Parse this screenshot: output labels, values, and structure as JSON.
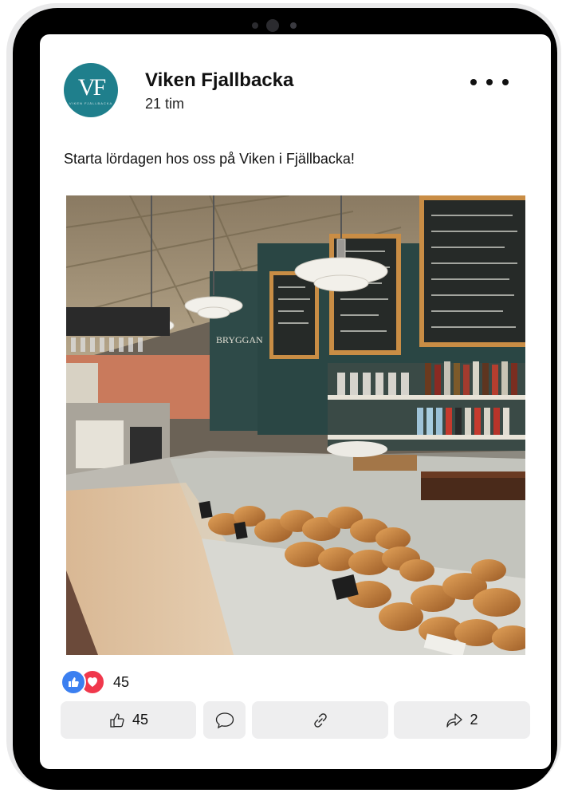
{
  "post": {
    "page_name": "Viken Fjallbacka",
    "timestamp": "21 tim",
    "text": "Starta lördagen hos oss på Viken i Fjällbacka!",
    "avatar": {
      "monogram": "VF",
      "subtext": "VIKEN FJÄLLBACKA",
      "color": "#1f7f8c"
    },
    "more_icon": "more-horizontal-icon"
  },
  "photo": {
    "description_icon": "bakery-cafe-photo",
    "sign_text": "BRYGGAN"
  },
  "reactions": {
    "types": [
      "like",
      "love"
    ],
    "count": "45",
    "like_color": "#3b7ff0",
    "love_color": "#f0384c"
  },
  "actions": {
    "like_count": "45",
    "share_count": "2",
    "button_bg": "#eeeeef"
  }
}
